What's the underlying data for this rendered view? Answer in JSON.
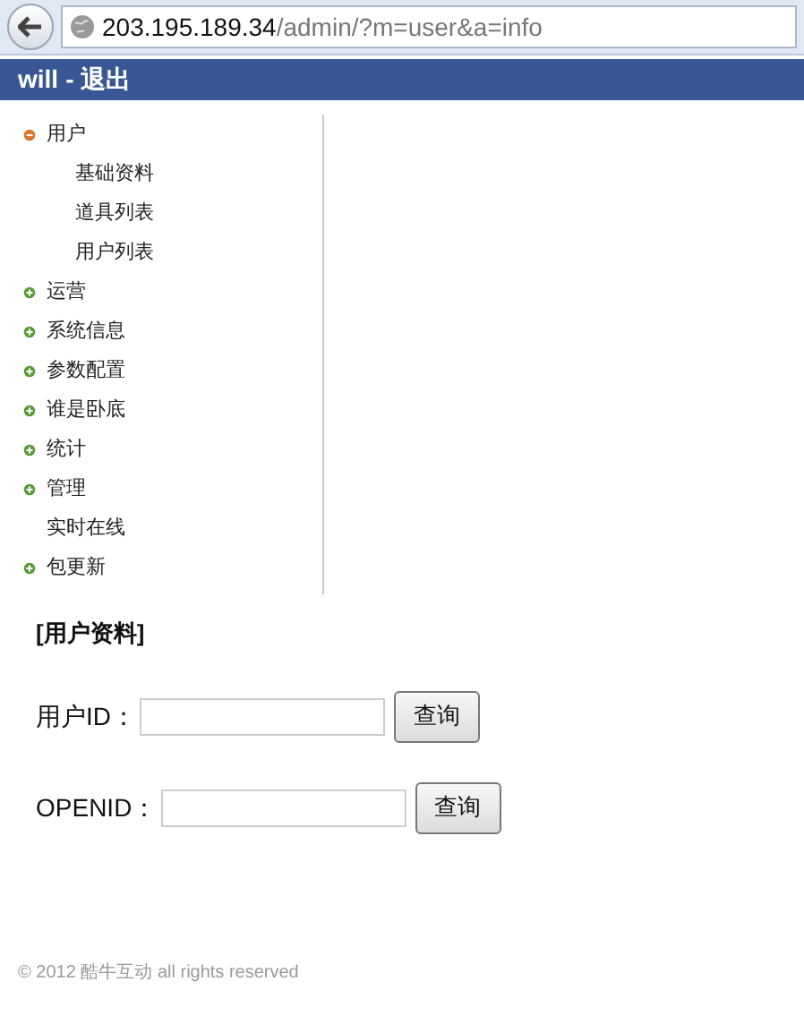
{
  "browser": {
    "host": "203.195.189.34",
    "path": "/admin/?m=user&a=info"
  },
  "header": {
    "user": "will",
    "separator": "-",
    "logout": "退出"
  },
  "sidebar": {
    "items": [
      {
        "kind": "group",
        "label": "用户",
        "expanded": true,
        "children": [
          {
            "label": "基础资料"
          },
          {
            "label": "道具列表"
          },
          {
            "label": "用户列表"
          }
        ]
      },
      {
        "kind": "group",
        "label": "运营",
        "expanded": false
      },
      {
        "kind": "group",
        "label": "系统信息",
        "expanded": false
      },
      {
        "kind": "group",
        "label": "参数配置",
        "expanded": false
      },
      {
        "kind": "group",
        "label": "谁是卧底",
        "expanded": false
      },
      {
        "kind": "group",
        "label": "统计",
        "expanded": false
      },
      {
        "kind": "group",
        "label": "管理",
        "expanded": false
      },
      {
        "kind": "link",
        "label": "实时在线"
      },
      {
        "kind": "group",
        "label": "包更新",
        "expanded": false
      }
    ]
  },
  "section_title": "[用户资料]",
  "forms": [
    {
      "label": "用户ID：",
      "button": "查询"
    },
    {
      "label": "OPENID：",
      "button": "查询"
    }
  ],
  "footer": "© 2012 酷牛互动 all rights reserved"
}
